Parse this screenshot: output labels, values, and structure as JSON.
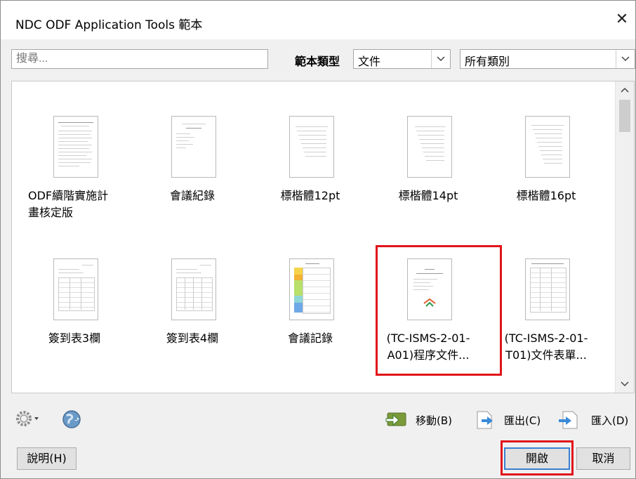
{
  "window": {
    "title": "NDC ODF Application Tools 範本",
    "close_glyph": "✕"
  },
  "filter": {
    "search_placeholder": "搜尋...",
    "type_label": "範本類型",
    "type_value": "文件",
    "category_value": "所有類別"
  },
  "templates": [
    {
      "name_line1": "ODF續階實施計",
      "name_line2": "畫核定版"
    },
    {
      "name_line1": "會議紀錄",
      "name_line2": ""
    },
    {
      "name_line1": "標楷體12pt",
      "name_line2": ""
    },
    {
      "name_line1": "標楷體14pt",
      "name_line2": ""
    },
    {
      "name_line1": "標楷體16pt",
      "name_line2": ""
    },
    {
      "name_line1": "簽到表3欄",
      "name_line2": ""
    },
    {
      "name_line1": "簽到表4欄",
      "name_line2": ""
    },
    {
      "name_line1": "會議記錄",
      "name_line2": ""
    },
    {
      "name_line1": "(TC-ISMS-2-01-",
      "name_line2": "A01)程序文件..."
    },
    {
      "name_line1": "(TC-ISMS-2-01-",
      "name_line2": "T01)文件表單..."
    }
  ],
  "selected_template_index": 8,
  "actions": {
    "move": "移動(B)",
    "export": "匯出(C)",
    "import": "匯入(D)"
  },
  "buttons": {
    "help": "說明(H)",
    "open": "開啟",
    "cancel": "取消"
  },
  "colors": {
    "highlight": "#e0141a",
    "dialog_bg": "#f0f0f0"
  },
  "icons": [
    "gear-icon",
    "globe-icon",
    "move-icon",
    "export-icon",
    "import-icon",
    "close-icon",
    "chevron-down-icon",
    "scroll-up-icon",
    "scroll-down-icon"
  ]
}
